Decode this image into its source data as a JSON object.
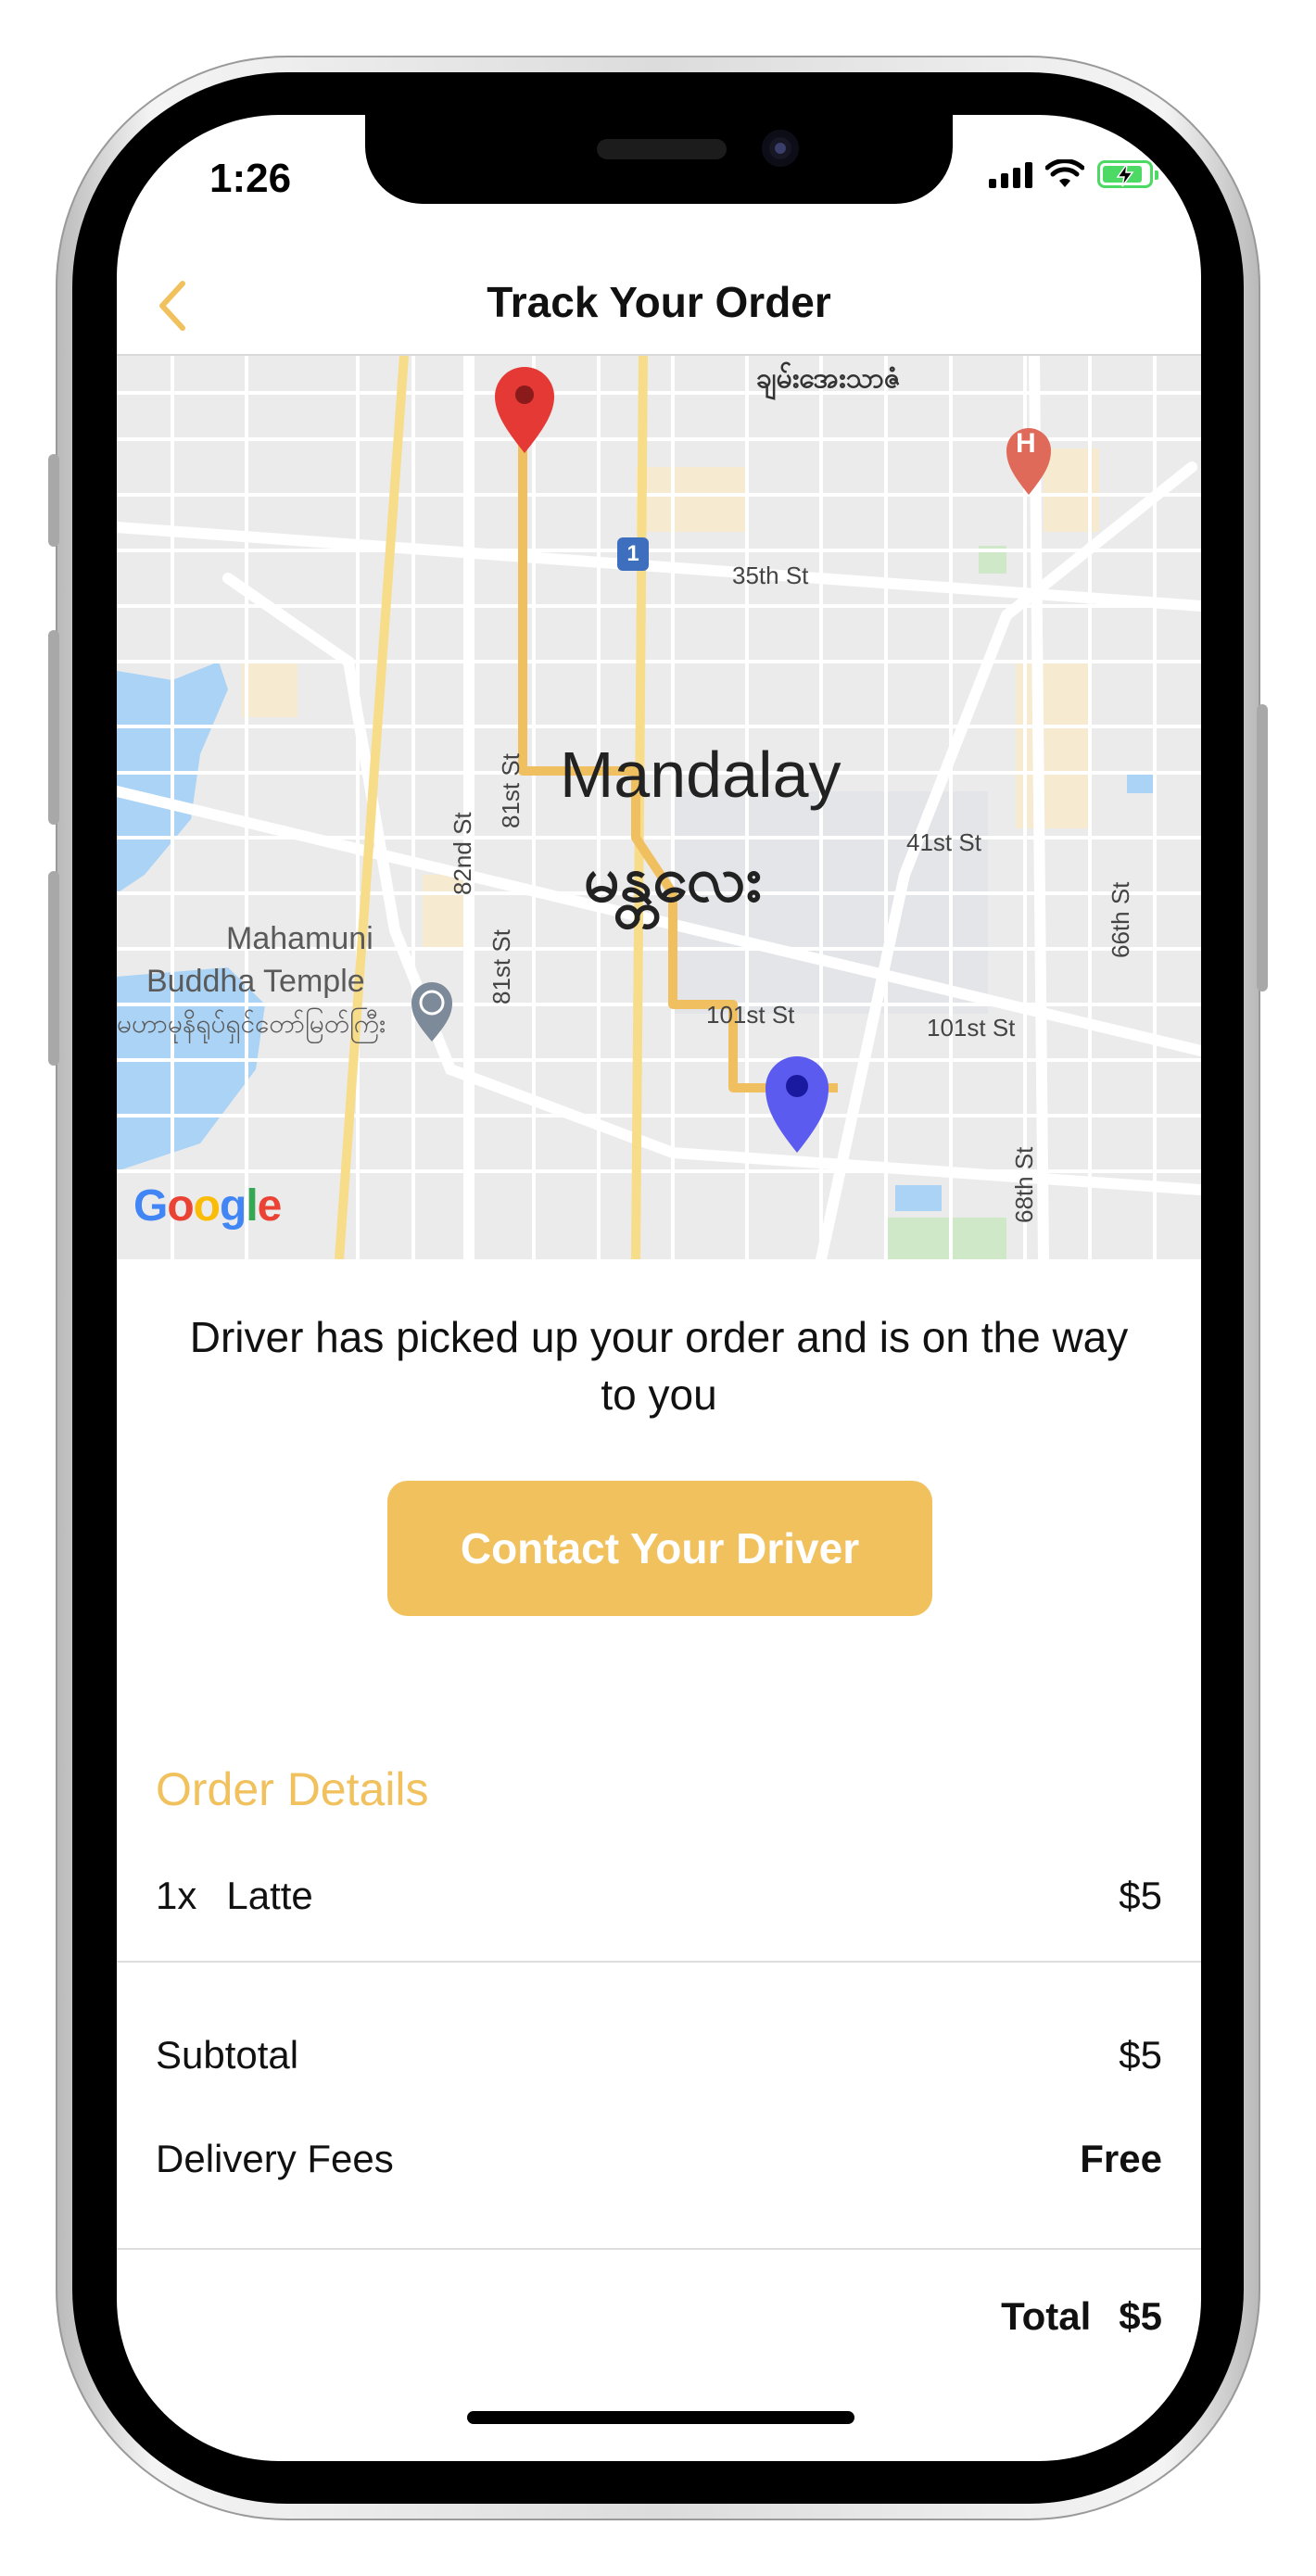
{
  "status_bar": {
    "time": "1:26"
  },
  "header": {
    "title": "Track Your Order"
  },
  "map": {
    "city_name": "Mandalay",
    "city_name_local": "မန္တလေး",
    "streets": {
      "s35": "35th St",
      "s41": "41st St",
      "s101a": "101st St",
      "s101b": "101st St",
      "s82": "82nd St",
      "s81a": "81st St",
      "s81b": "81st St",
      "s66": "66th St",
      "s68": "68th St"
    },
    "road_badge": "1",
    "poi_name_line1": "Mahamuni",
    "poi_name_line2": "Buddha Temple",
    "poi_name_local": "မဟာမုနိရုပ်ရှင်တော်မြတ်ကြီး",
    "place_top": "ချမ်းအေးသာဇံ",
    "hospital_letter": "H",
    "attribution": "Google",
    "colors": {
      "route": "#f0c060",
      "origin_pin": "#e53935",
      "driver_pin": "#5b5bf0",
      "water": "#aad3f5"
    }
  },
  "delivery_status": "Driver has picked up your order and is on the way to you",
  "contact_button": {
    "label": "Contact Your Driver"
  },
  "order": {
    "title": "Order Details",
    "items": [
      {
        "qty": "1x",
        "name": "Latte",
        "price": "$5"
      }
    ],
    "subtotal_label": "Subtotal",
    "subtotal_value": "$5",
    "delivery_label": "Delivery Fees",
    "delivery_value": "Free",
    "total_label": "Total",
    "total_value": "$5"
  },
  "colors": {
    "accent": "#f1c15e"
  }
}
